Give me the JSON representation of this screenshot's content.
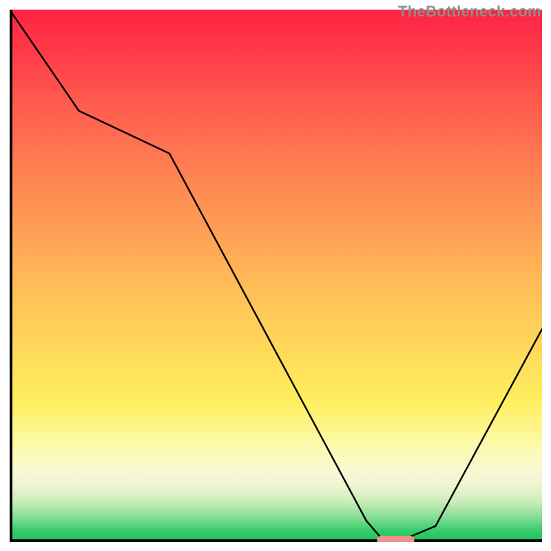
{
  "attribution": "TheBottleneck.com",
  "chart_data": {
    "type": "line",
    "title": "",
    "xlabel": "",
    "ylabel": "",
    "xlim": [
      0,
      100
    ],
    "ylim": [
      0,
      100
    ],
    "x": [
      0,
      13,
      30,
      67,
      70,
      74,
      80,
      100
    ],
    "values": [
      100,
      81,
      73,
      4,
      0.5,
      0.5,
      3,
      40
    ],
    "marker": {
      "x_start": 69,
      "x_end": 76,
      "y": 0
    },
    "background": "vertical red→green gradient",
    "axes": {
      "left": true,
      "bottom": true,
      "top": false,
      "right": false
    }
  },
  "colors": {
    "curve": "#000000",
    "marker": "#f2918b",
    "axis": "#000000",
    "gradient_top": "#ff2244",
    "gradient_bottom": "#20c560",
    "attribution": "#8e8e8e"
  }
}
